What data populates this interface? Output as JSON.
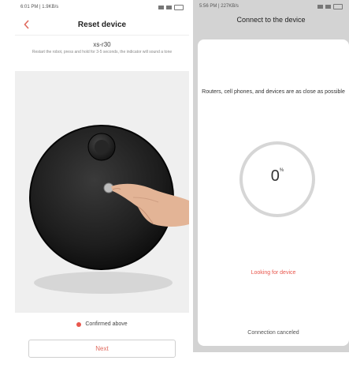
{
  "left_screen": {
    "status_time": "6:01 PM | 1.9KB/s",
    "title": "Reset device",
    "model": "xs-r30",
    "instruction": "Restart the robot, press and hold for 3-5 seconds, the indicator will sound a tone",
    "confirm_label": "Confirmed above",
    "next_label": "Next"
  },
  "right_screen": {
    "status_time": "5:56 PM | 227KB/s",
    "title": "Connect to the device",
    "hint": "Routers, cell phones, and devices are as close as possible",
    "progress_value": "0",
    "progress_unit": "%",
    "status": "Looking for device",
    "cancel_label": "Connection canceled"
  },
  "colors": {
    "accent_red": "#e8574d",
    "ring_gray": "#d6d6d6"
  },
  "icons": {
    "back": "chevron-left-icon",
    "signal": "signal-icon",
    "wifi": "wifi-icon",
    "battery": "battery-icon"
  }
}
